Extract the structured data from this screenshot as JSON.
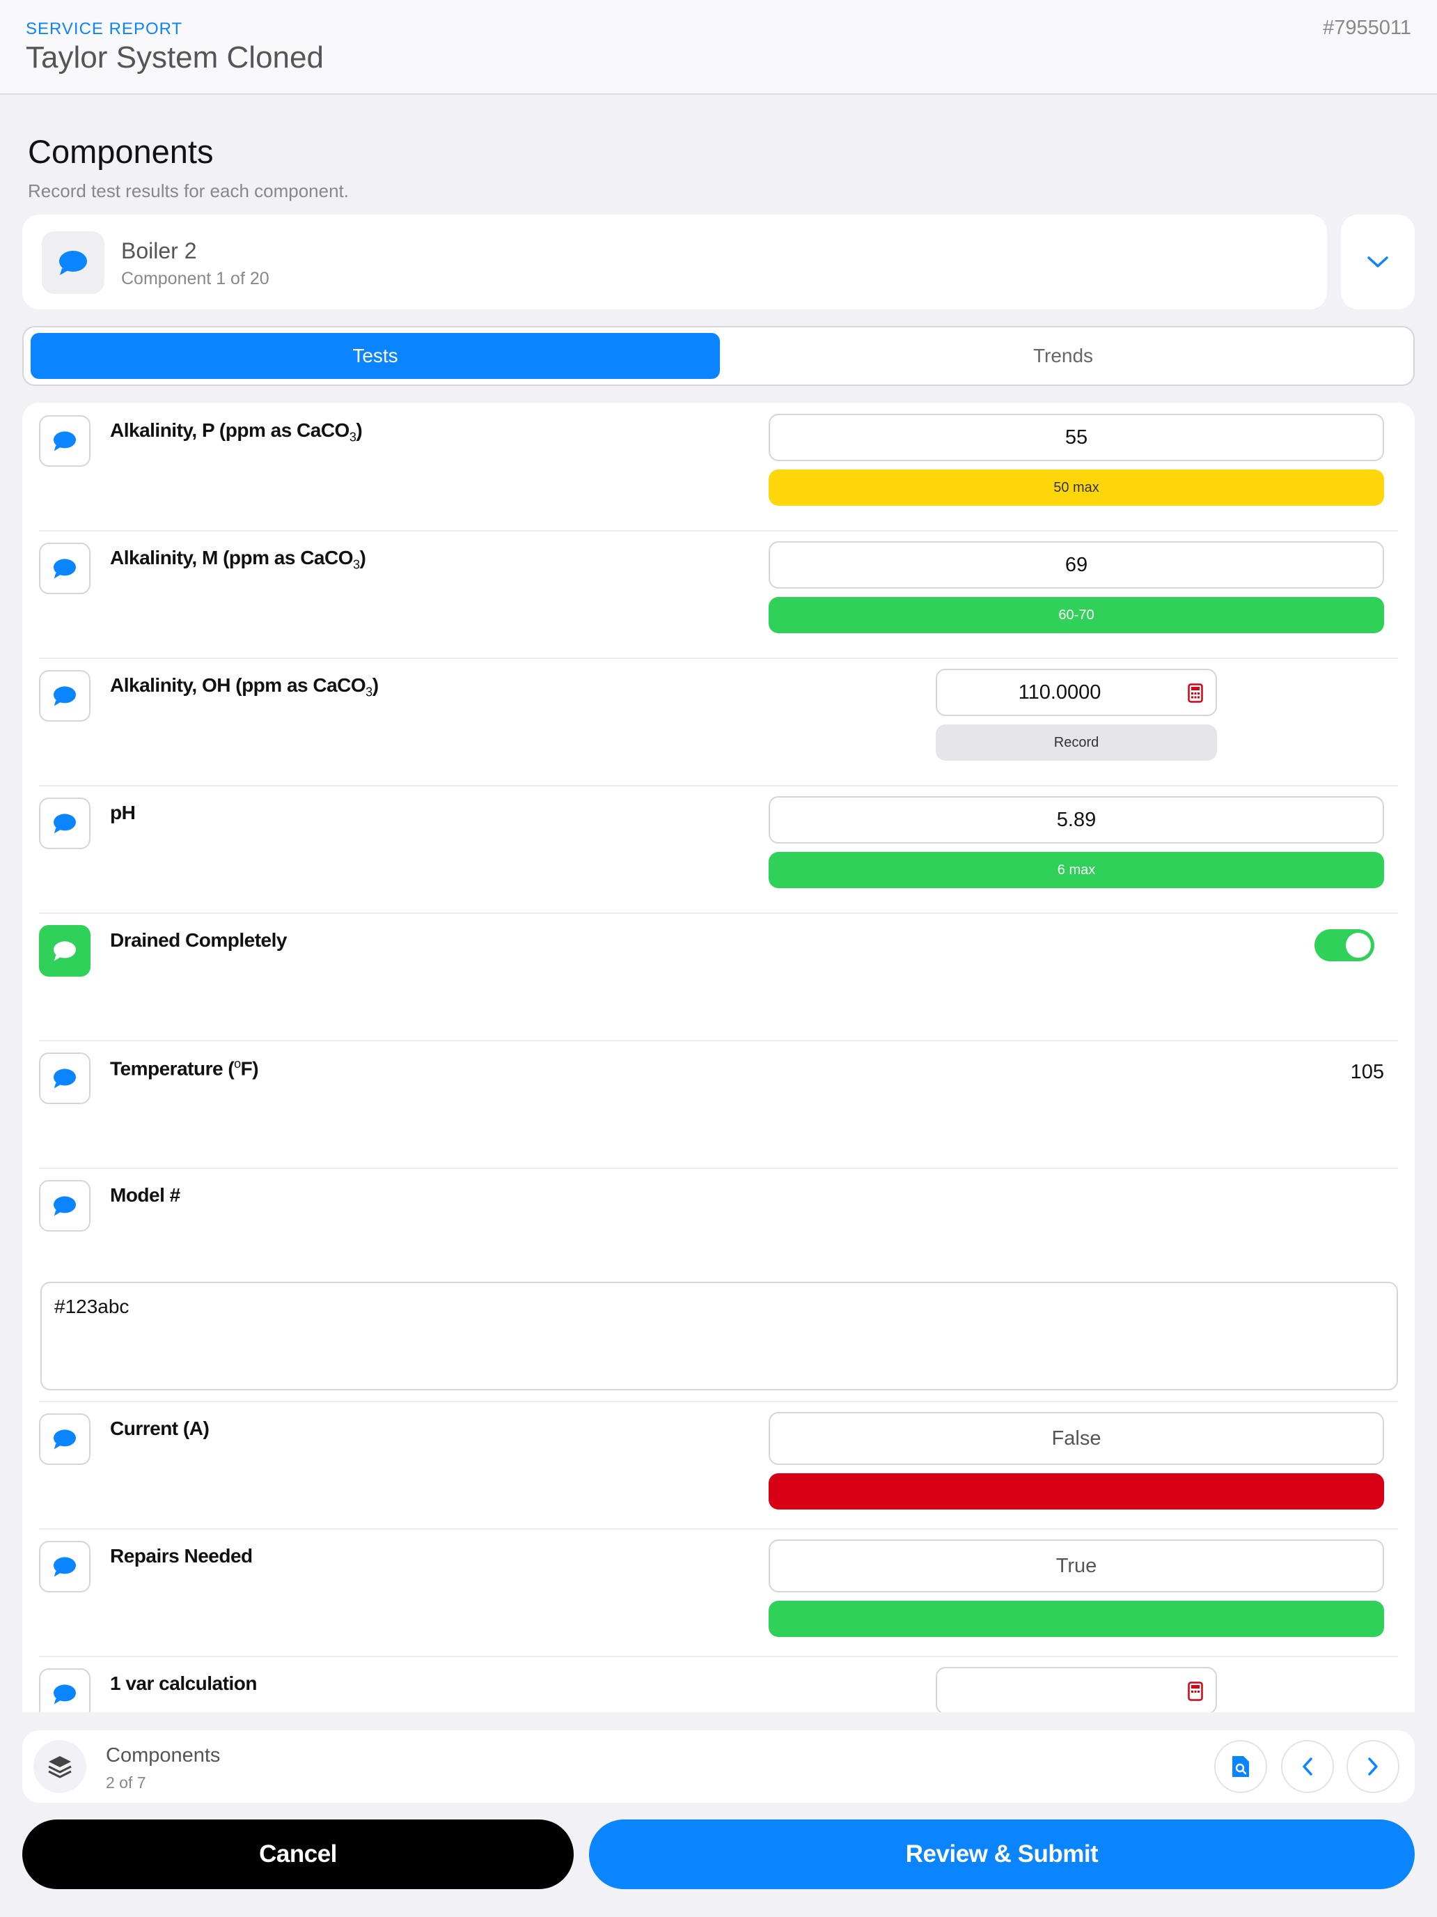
{
  "header": {
    "kicker": "SERVICE REPORT",
    "title": "Taylor System Cloned",
    "report_id": "#7955011"
  },
  "section": {
    "title": "Components",
    "subtitle": "Record test results for each component."
  },
  "component": {
    "name": "Boiler 2",
    "count": "Component 1 of 20",
    "icon": "chat-bubble-icon",
    "toggle_icon": "chevron-down-icon"
  },
  "tabs": {
    "tests": "Tests",
    "trends": "Trends",
    "active": "Tests"
  },
  "tests": [
    {
      "label": "Alkalinity, P (ppm as CaCO",
      "sub": "3",
      "suffix": ")",
      "value": "55",
      "range": "50 max",
      "status": "yellow"
    },
    {
      "label": "Alkalinity, M (ppm as CaCO",
      "sub": "3",
      "suffix": ")",
      "value": "69",
      "range": "60-70",
      "status": "green"
    },
    {
      "label": "Alkalinity, OH (ppm as CaCO",
      "sub": "3",
      "suffix": ")",
      "value": "110.0000",
      "action": "Record",
      "icon": "calculator-icon"
    },
    {
      "label": "pH",
      "value": "5.89",
      "range": "6 max",
      "status": "green"
    },
    {
      "label": "Drained Completely",
      "toggle_on": true
    },
    {
      "label_pre": "Temperature (",
      "sup": "o",
      "label_post": "F)",
      "value": "105"
    },
    {
      "label": "Model #",
      "value": "#123abc"
    },
    {
      "label": "Current (A)",
      "value": "False",
      "status": "red"
    },
    {
      "label": "Repairs Needed",
      "value": "True",
      "status": "green"
    },
    {
      "label": "1 var calculation",
      "value": "",
      "icon": "calculator-icon"
    }
  ],
  "bottom_bar": {
    "title": "Components",
    "count": "2 of 7",
    "icons": [
      "layers-icon",
      "document-search-icon",
      "chevron-left-icon",
      "chevron-right-icon"
    ]
  },
  "actions": {
    "cancel": "Cancel",
    "submit": "Review & Submit"
  },
  "colors": {
    "accent": "#0a84ff",
    "warning": "#ffd60a",
    "success": "#30d158",
    "danger": "#d70015"
  }
}
